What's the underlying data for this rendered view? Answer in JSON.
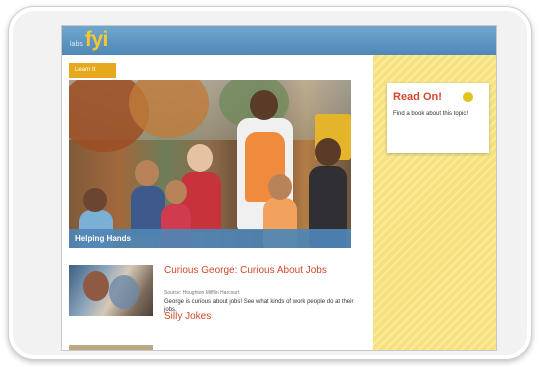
{
  "header": {
    "logo_prefix": "labs",
    "logo_text": "fyi"
  },
  "main": {
    "section_tab": "Learn It",
    "hero": {
      "caption": "Helping Hands"
    },
    "articles": [
      {
        "title": "Curious George: Curious About Jobs",
        "source": "Source: Houghton Mifflin Harcourt",
        "description": "George is curious about jobs! See what kinds of work people do at their jobs."
      },
      {
        "title": "Silly Jokes"
      }
    ]
  },
  "sidebar": {
    "readon": {
      "title": "Read On!",
      "description": "Find a book about this topic!"
    }
  },
  "colors": {
    "topbar": "#5b93c1",
    "logo": "#f7c72b",
    "accent_orange": "#e6a91d",
    "link_red": "#d2472b",
    "sidebar_yellow": "#f6e27d"
  }
}
